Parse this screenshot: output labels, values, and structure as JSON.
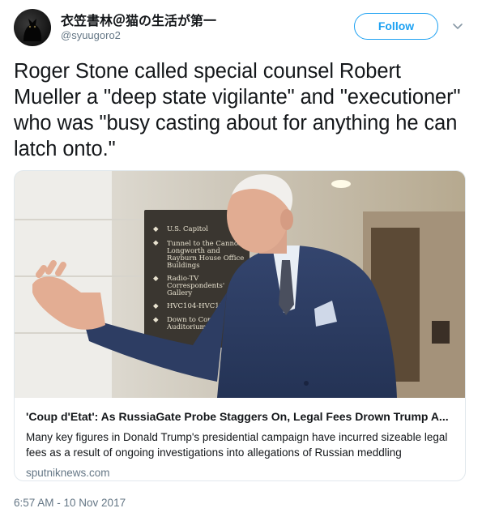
{
  "user": {
    "display_name": "衣笠書林＠猫の生活が第一",
    "handle": "@syuugoro2",
    "avatar": "cat-silhouette-avatar"
  },
  "follow": {
    "label": "Follow",
    "color": "#1da1f2"
  },
  "menu": {
    "icon": "chevron-down-icon"
  },
  "tweet": {
    "text": "Roger Stone called special counsel Robert Mueller a \"deep state vigilante\" and \"executioner\" who was \"busy casting about for anything he can latch onto.\""
  },
  "card": {
    "sign": [
      "U.S. Capitol",
      "Tunnel to the Cannon",
      "Longworth and",
      "Rayburn House Office",
      "Buildings",
      "Radio-TV",
      "Correspondents'",
      "Gallery",
      "HVC104-HVC1?",
      "Down to Cong",
      "Auditorium"
    ],
    "title": "'Coup d'Etat': As RussiaGate Probe Staggers On, Legal Fees Drown Trump A...",
    "description": "Many key figures in Donald Trump's presidential campaign have incurred sizeable legal fees as a result of ongoing investigations into allegations of Russian meddling",
    "domain": "sputniknews.com"
  },
  "timestamp": "6:57 AM - 10 Nov 2017",
  "colors": {
    "text": "#14171a",
    "secondary": "#657786",
    "border": "#e1e8ed"
  }
}
